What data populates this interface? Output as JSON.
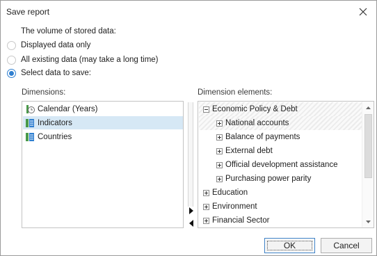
{
  "window": {
    "title": "Save report",
    "close_icon": "close-icon"
  },
  "volume": {
    "label": "The volume of stored data:",
    "options": [
      {
        "label": "Displayed data only",
        "checked": false
      },
      {
        "label": "All existing data (may take a long time)",
        "checked": false
      },
      {
        "label": "Select data to save:",
        "checked": true
      }
    ]
  },
  "dimensions": {
    "label": "Dimensions:",
    "items": [
      {
        "label": "Calendar (Years)",
        "icon": "calendar-dimension-icon",
        "selected": false
      },
      {
        "label": "Indicators",
        "icon": "dictionary-icon",
        "selected": true
      },
      {
        "label": "Countries",
        "icon": "dictionary-icon",
        "selected": false
      }
    ]
  },
  "elements": {
    "label": "Dimension elements:",
    "rows": [
      {
        "label": "Economic Policy & Debt",
        "level": 0,
        "expanded": true,
        "hatched": true
      },
      {
        "label": "National accounts",
        "level": 1,
        "expanded": false,
        "hatched": true
      },
      {
        "label": "Balance of payments",
        "level": 1,
        "expanded": false,
        "hatched": false
      },
      {
        "label": "External debt",
        "level": 1,
        "expanded": false,
        "hatched": false
      },
      {
        "label": "Official development assistance",
        "level": 1,
        "expanded": false,
        "hatched": false
      },
      {
        "label": "Purchasing power parity",
        "level": 1,
        "expanded": false,
        "hatched": false
      },
      {
        "label": "Education",
        "level": 0,
        "expanded": false,
        "hatched": false
      },
      {
        "label": "Environment",
        "level": 0,
        "expanded": false,
        "hatched": false
      },
      {
        "label": "Financial Sector",
        "level": 0,
        "expanded": false,
        "hatched": false
      }
    ]
  },
  "buttons": {
    "ok": "OK",
    "cancel": "Cancel"
  },
  "colors": {
    "accent": "#2f7fd0",
    "selection": "#d6e8f5"
  }
}
